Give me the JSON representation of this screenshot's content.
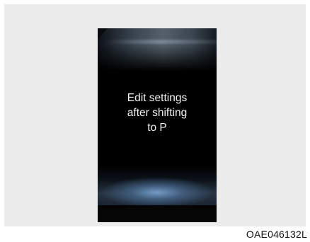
{
  "display": {
    "message_lines": [
      "Edit settings",
      "after shifting",
      "to P"
    ]
  },
  "figure": {
    "code": "OAE046132L"
  }
}
